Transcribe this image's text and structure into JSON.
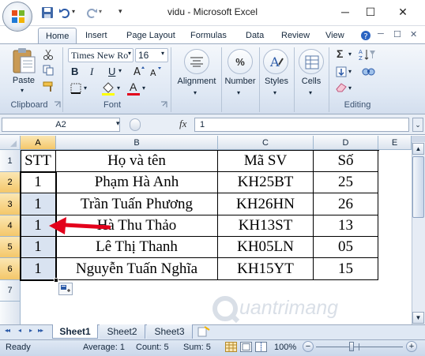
{
  "window": {
    "title": "vidu - Microsoft Excel",
    "minimize": "─",
    "maximize": "☐",
    "close": "✕"
  },
  "tabs": [
    "Home",
    "Insert",
    "Page Layout",
    "Formulas",
    "Data",
    "Review",
    "View"
  ],
  "ribbon": {
    "clipboard": {
      "paste": "Paste",
      "label": "Clipboard"
    },
    "font": {
      "name": "Times New Ro",
      "size": "16",
      "label": "Font",
      "bold": "B",
      "italic": "I",
      "underline": "U",
      "underline_arrow": "▾",
      "font_color_glyph": "A"
    },
    "alignment": {
      "label": "Alignment"
    },
    "number": {
      "label": "Number",
      "glyph": "%"
    },
    "styles": {
      "label": "Styles"
    },
    "cells": {
      "label": "Cells"
    },
    "editing": {
      "label": "Editing",
      "sum_glyph": "Σ"
    }
  },
  "formula_bar": {
    "name_box": "A2",
    "fx": "fx",
    "value": "1"
  },
  "columns": [
    "A",
    "B",
    "C",
    "D",
    "E"
  ],
  "rows": [
    "1",
    "2",
    "3",
    "4",
    "5",
    "6",
    "7"
  ],
  "table": {
    "headers": [
      "STT",
      "Họ và tên",
      "Mã SV",
      "Số"
    ],
    "rows": [
      [
        "1",
        "Phạm Hà Anh",
        "KH25BT",
        "25"
      ],
      [
        "1",
        "Trần Tuấn Phương",
        "KH26HN",
        "26"
      ],
      [
        "1",
        "Hà Thu Thảo",
        "KH13ST",
        "13"
      ],
      [
        "1",
        "Lê Thị Thanh",
        "KH05LN",
        "05"
      ],
      [
        "1",
        "Nguyễn Tuấn Nghĩa",
        "KH15YT",
        "15"
      ]
    ]
  },
  "sheets": [
    "Sheet1",
    "Sheet2",
    "Sheet3"
  ],
  "sheet_nav": [
    "◂◂",
    "◂",
    "▸",
    "▸▸"
  ],
  "status": {
    "ready": "Ready",
    "average": "Average: 1",
    "count": "Count: 5",
    "sum": "Sum: 5",
    "zoom": "100%",
    "zoom_minus": "−",
    "zoom_plus": "+"
  },
  "watermark": "uantrimang",
  "colors": {
    "accent_red": "#e3001b",
    "selection_header": "#f4c76a",
    "ribbon_blue": "#dfe8f4"
  }
}
